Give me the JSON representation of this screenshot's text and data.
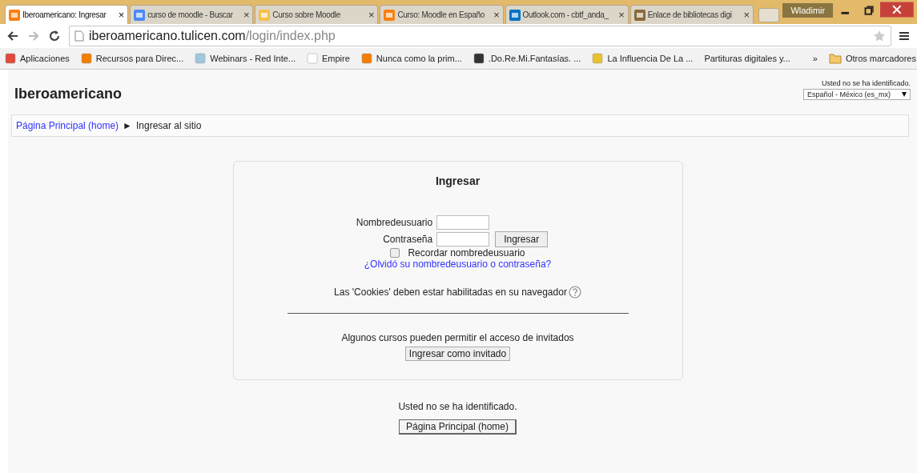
{
  "browser": {
    "tabs": [
      {
        "title": "Iberoamericano: Ingresar",
        "kind": "moodle",
        "selected": true
      },
      {
        "title": "curso de moodle - Buscar",
        "kind": "google",
        "selected": false
      },
      {
        "title": "Curso sobre Moodle",
        "kind": "hand",
        "selected": false
      },
      {
        "title": "Curso: Moodle en Españo",
        "kind": "moodle-box",
        "selected": false
      },
      {
        "title": "Outlook.com - cbtf_anda_",
        "kind": "outlook",
        "selected": false
      },
      {
        "title": "Enlace de bibliotecas digi",
        "kind": "book",
        "selected": false
      }
    ],
    "close_glyph": "×",
    "profile": "Wladimir",
    "address": {
      "host": "iberoamericano.tulicen.com",
      "path": "/login/index.php"
    },
    "bookmarks": [
      {
        "label": "Aplicaciones",
        "kind": "apps"
      },
      {
        "label": "Recursos para Direc...",
        "kind": "blogger"
      },
      {
        "label": "Webinars - Red Inte...",
        "kind": "webinar"
      },
      {
        "label": "Empire",
        "kind": "page"
      },
      {
        "label": "Nunca como la prim...",
        "kind": "blogger"
      },
      {
        "label": ".Do.Re.Mi.Fantasías. ...",
        "kind": "music"
      },
      {
        "label": "La Influencia De La ...",
        "kind": "pencil"
      },
      {
        "label": "Partituras digitales y...",
        "kind": "none"
      }
    ],
    "more_glyph": "»",
    "other_bookmarks": "Otros marcadores"
  },
  "page": {
    "site_name": "Iberoamericano",
    "login_info": "Usted no se ha identificado.",
    "language": "Español - México (es_mx)",
    "breadcrumb": {
      "home": "Página Principal (home)",
      "separator": "►",
      "current": "Ingresar al sitio"
    },
    "login": {
      "title": "Ingresar",
      "username_label": "Nombredeusuario",
      "password_label": "Contraseña",
      "submit": "Ingresar",
      "remember": {
        "label": "Recordar nombredeusuario",
        "checked": false
      },
      "forgot": "¿Olvidó su nombredeusuario o contraseña?",
      "cookies": "Las 'Cookies' deben estar habilitadas en su navegador",
      "guest_note": "Algunos cursos pueden permitir el acceso de invitados",
      "guest_button": "Ingresar como invitado"
    },
    "footer": {
      "login_info": "Usted no se ha identificado.",
      "home_button": "Página Principal (home)"
    }
  }
}
